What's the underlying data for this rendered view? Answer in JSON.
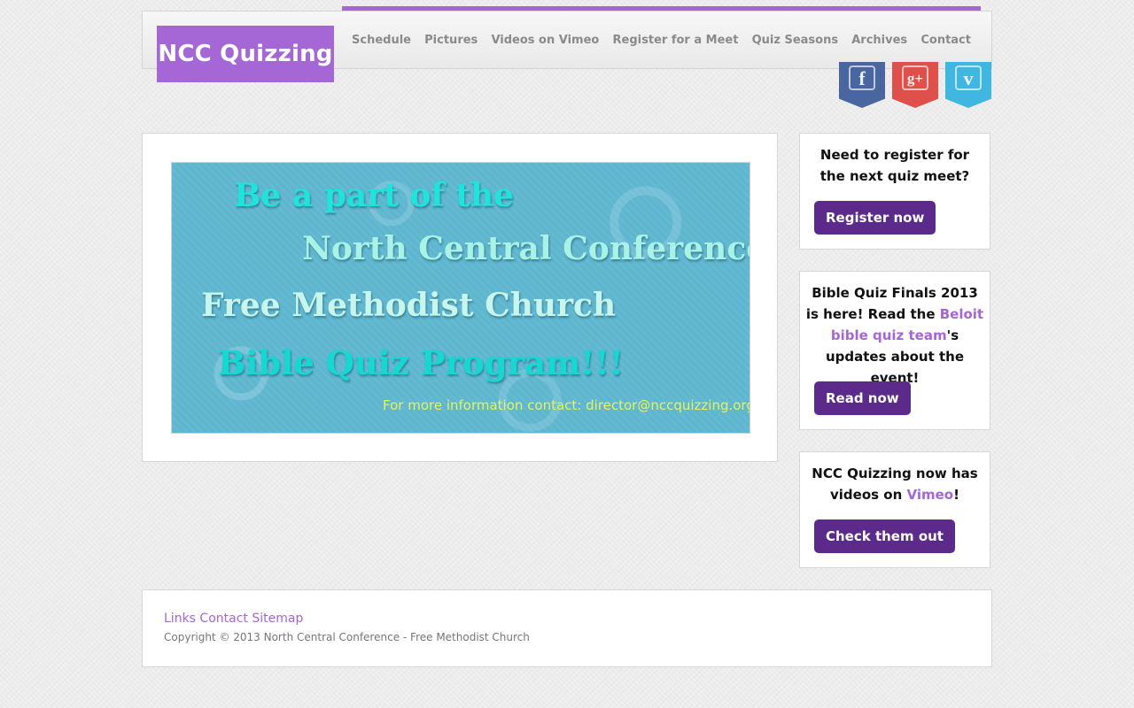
{
  "site": {
    "logo": "NCC Quizzing"
  },
  "nav": {
    "items": [
      {
        "label": "Schedule"
      },
      {
        "label": "Pictures"
      },
      {
        "label": "Videos on Vimeo"
      },
      {
        "label": "Register for a Meet"
      },
      {
        "label": "Quiz Seasons"
      },
      {
        "label": "Archives"
      },
      {
        "label": "Contact"
      }
    ]
  },
  "social": {
    "facebook": {
      "glyph": "f",
      "icon": "facebook-icon",
      "color": "#4a66a0"
    },
    "googleplus": {
      "glyph": "g+",
      "icon": "google-plus-icon",
      "color": "#e0504a"
    },
    "vimeo": {
      "glyph": "v",
      "icon": "vimeo-icon",
      "color": "#3fb7e0"
    }
  },
  "banner": {
    "line1": "Be a part of the",
    "line2": "North Central Conference",
    "line3": "Free Methodist Church",
    "line4": "Bible Quiz Program!!!",
    "line5": "For more information contact: director@nccquizzing.org"
  },
  "sidebar": {
    "register": {
      "text": "Need to register for the next quiz meet?",
      "button": "Register now"
    },
    "finals": {
      "text_before": "Bible Quiz Finals 2013 is here! Read the ",
      "link": "Beloit bible quiz team",
      "text_after": "'s updates about the event!",
      "button": "Read now"
    },
    "vimeo": {
      "text_before": "NCC Quizzing now has videos on ",
      "link": "Vimeo",
      "text_after": "!",
      "button": "Check them out"
    }
  },
  "footer": {
    "links": [
      "Links",
      "Contact",
      "Sitemap"
    ],
    "copyright": "Copyright © 2013 North Central Conference - Free Methodist Church"
  },
  "colors": {
    "accent": "#a566d6",
    "button": "#5b2a8a"
  }
}
